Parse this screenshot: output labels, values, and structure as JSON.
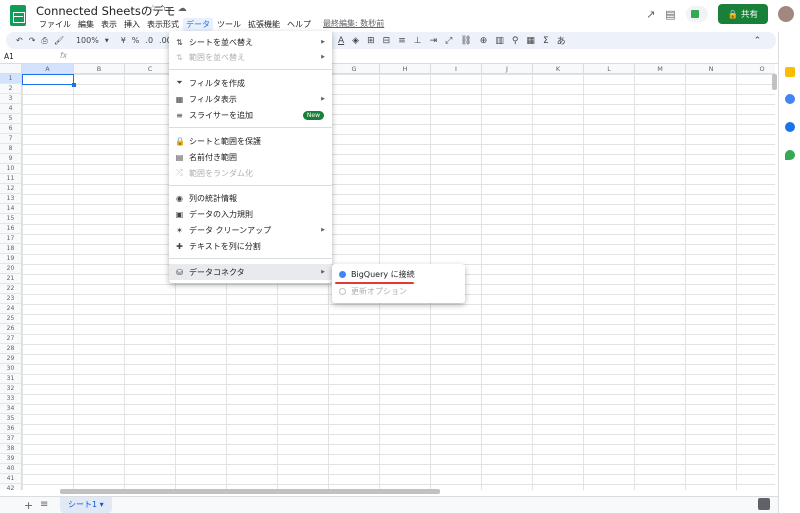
{
  "header": {
    "title": "Connected Sheetsのデモ",
    "menus": [
      "ファイル",
      "編集",
      "表示",
      "挿入",
      "表示形式",
      "データ",
      "ツール",
      "拡張機能",
      "ヘルプ"
    ],
    "active_menu": "データ",
    "last_edit": "最終編集: 数秒前",
    "share_label": "共有"
  },
  "toolbar": {
    "zoom": "100%",
    "currency": "¥",
    "percent": "%",
    "decimal_dec": ".0",
    "decimal_inc": ".00"
  },
  "formula_bar": {
    "name_box": "A1",
    "fx": "fx"
  },
  "grid": {
    "columns": [
      "A",
      "B",
      "C",
      "D",
      "E",
      "F",
      "G",
      "H",
      "I",
      "J",
      "K",
      "L",
      "M",
      "N",
      "O"
    ],
    "rows": [
      "1",
      "2",
      "3",
      "4",
      "5",
      "6",
      "7",
      "8",
      "9",
      "10",
      "11",
      "12",
      "13",
      "14",
      "15",
      "16",
      "17",
      "18",
      "19",
      "20",
      "21",
      "22",
      "23",
      "24",
      "25",
      "26",
      "27",
      "28",
      "29",
      "30",
      "31",
      "32",
      "33",
      "34",
      "35",
      "36",
      "37",
      "38",
      "39",
      "40",
      "41",
      "42"
    ],
    "selected_cell": "A1"
  },
  "data_menu": {
    "items": [
      {
        "label": "シートを並べ替え",
        "icon": "sort-icon",
        "arrow": true,
        "disabled": false
      },
      {
        "label": "範囲を並べ替え",
        "icon": "sort-range-icon",
        "arrow": true,
        "disabled": true
      },
      {
        "label": "フィルタを作成",
        "icon": "filter-icon",
        "arrow": false,
        "disabled": false
      },
      {
        "label": "フィルタ表示",
        "icon": "filter-view-icon",
        "arrow": true,
        "disabled": false
      },
      {
        "label": "スライサーを追加",
        "icon": "slicer-icon",
        "arrow": false,
        "disabled": false,
        "badge": "New"
      },
      {
        "label": "シートと範囲を保護",
        "icon": "lock-icon",
        "arrow": false,
        "disabled": false
      },
      {
        "label": "名前付き範囲",
        "icon": "named-range-icon",
        "arrow": false,
        "disabled": false
      },
      {
        "label": "範囲をランダム化",
        "icon": "shuffle-icon",
        "arrow": false,
        "disabled": true
      },
      {
        "label": "列の統計情報",
        "icon": "lightbulb-icon",
        "arrow": false,
        "disabled": false
      },
      {
        "label": "データの入力規則",
        "icon": "validation-icon",
        "arrow": false,
        "disabled": false
      },
      {
        "label": "データ クリーンアップ",
        "icon": "cleanup-icon",
        "arrow": true,
        "disabled": false
      },
      {
        "label": "テキストを列に分割",
        "icon": "split-icon",
        "arrow": false,
        "disabled": false
      },
      {
        "label": "データコネクタ",
        "icon": "database-icon",
        "arrow": true,
        "disabled": false
      }
    ]
  },
  "submenu": {
    "connect": "BigQuery に接続",
    "refresh": "更新オプション"
  },
  "bottom": {
    "sheet_tab": "シート1 ▾"
  },
  "colors": {
    "share_green": "#188038",
    "accent_blue": "#1a73e8",
    "underline_red": "#e53935"
  }
}
